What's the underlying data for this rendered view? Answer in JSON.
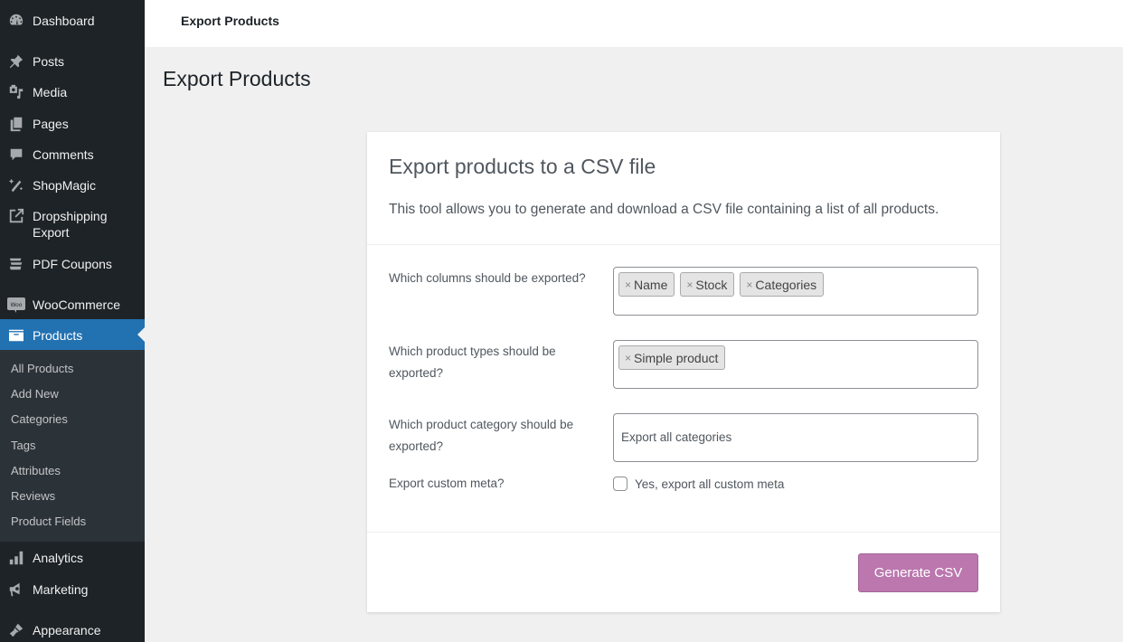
{
  "sidebar": {
    "items": [
      {
        "label": "Dashboard",
        "icon": "dashboard-icon"
      },
      {
        "label": "Posts",
        "icon": "pin-icon"
      },
      {
        "label": "Media",
        "icon": "media-icon"
      },
      {
        "label": "Pages",
        "icon": "pages-icon"
      },
      {
        "label": "Comments",
        "icon": "comment-icon"
      },
      {
        "label": "ShopMagic",
        "icon": "magic-wand-icon"
      },
      {
        "label": "Dropshipping Export",
        "icon": "external-link-icon"
      },
      {
        "label": "PDF Coupons",
        "icon": "coupons-icon"
      },
      {
        "label": "WooCommerce",
        "icon": "woo-icon"
      },
      {
        "label": "Products",
        "icon": "archive-box-icon",
        "active": true
      },
      {
        "label": "Analytics",
        "icon": "bar-chart-icon"
      },
      {
        "label": "Marketing",
        "icon": "megaphone-icon"
      },
      {
        "label": "Appearance",
        "icon": "paintbrush-icon"
      }
    ],
    "submenu": [
      "All Products",
      "Add New",
      "Categories",
      "Tags",
      "Attributes",
      "Reviews",
      "Product Fields"
    ],
    "active_color": "#2271b1"
  },
  "topbar": {
    "title": "Export Products"
  },
  "page": {
    "title": "Export Products"
  },
  "card": {
    "title": "Export products to a CSV file",
    "description": "This tool allows you to generate and download a CSV file containing a list of all products.",
    "fields": {
      "columns": {
        "label": "Which columns should be exported?",
        "tags": [
          "Name",
          "Stock",
          "Categories"
        ]
      },
      "types": {
        "label": "Which product types should be exported?",
        "tags": [
          "Simple product"
        ]
      },
      "category": {
        "label": "Which product category should be exported?",
        "placeholder": "Export all categories"
      },
      "meta": {
        "label": "Export custom meta?",
        "checkbox_label": "Yes, export all custom meta",
        "checked": false
      }
    },
    "button": {
      "label": "Generate CSV",
      "color": "#bb77ae"
    }
  }
}
